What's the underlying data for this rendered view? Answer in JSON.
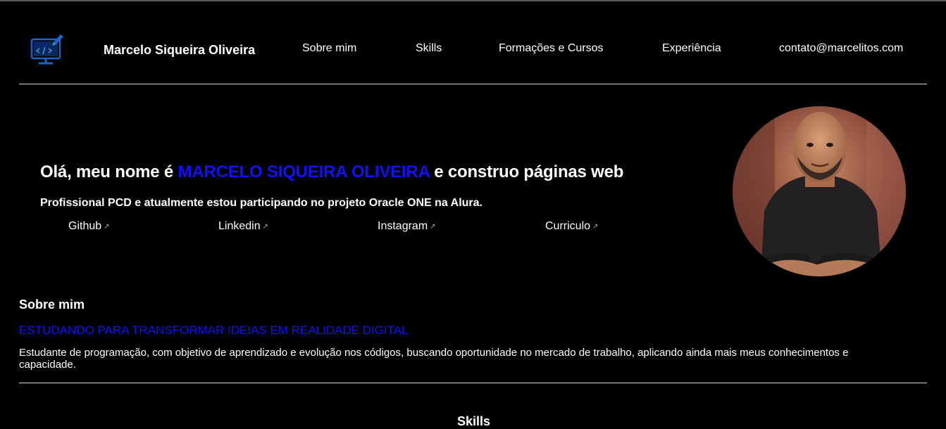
{
  "header": {
    "logo_icon": "computer-code-icon",
    "name": "Marcelo Siqueira Oliveira",
    "nav": [
      {
        "label": "Sobre mim"
      },
      {
        "label": "Skills"
      },
      {
        "label": "Formações e Cursos"
      },
      {
        "label": "Experiência"
      },
      {
        "label": "contato@marcelitos.com"
      }
    ]
  },
  "hero": {
    "greeting_prefix": "Olá, meu nome é",
    "greeting_name": "MARCELO SIQUEIRA OLIVEIRA",
    "greeting_suffix": "e construo páginas web",
    "subtitle": "Profissional PCD e atualmente estou participando no projeto Oracle ONE na Alura.",
    "links": [
      {
        "label": "Github",
        "icon": "external-link-icon"
      },
      {
        "label": "Linkedin",
        "icon": "external-link-icon"
      },
      {
        "label": "Instagram",
        "icon": "external-link-icon"
      },
      {
        "label": "Curriculo",
        "icon": "external-link-icon"
      }
    ],
    "arrow_glyph": "↗"
  },
  "about": {
    "title": "Sobre mim",
    "subtitle": "ESTUDANDO PARA TRANSFORMAR IDEIAS EM REALIDADE DIGITAL",
    "text": "Estudante de programação, com objetivo de aprendizado e evolução nos códigos, buscando oportunidade no mercado de trabalho, aplicando ainda mais meus conhecimentos e capacidade."
  },
  "skills": {
    "title": "Skills"
  },
  "colors": {
    "accent": "#1010ff",
    "background": "#000000",
    "text": "#ffffff",
    "logo_blue": "#1e64c8"
  }
}
